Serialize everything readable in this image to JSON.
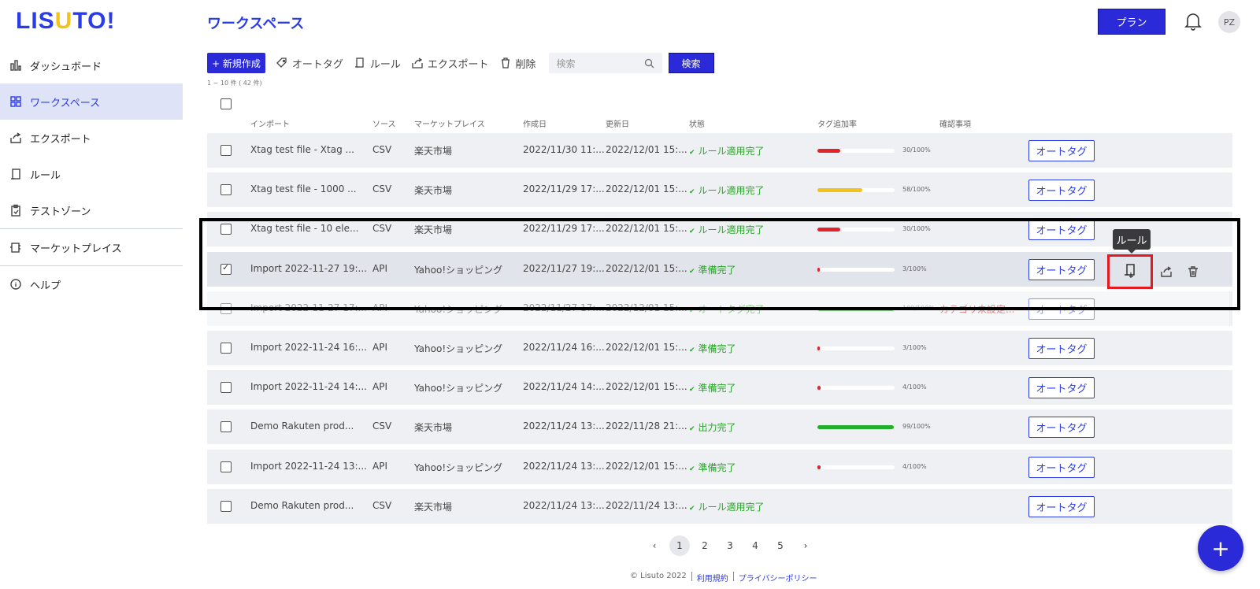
{
  "logo": {
    "text_a": "LIS",
    "text_u": "U",
    "text_b": "TO!"
  },
  "sidebar": {
    "items": [
      {
        "label": "ダッシュボード",
        "icon": "bar-chart-icon"
      },
      {
        "label": "ワークスペース",
        "icon": "grid-icon",
        "active": true
      },
      {
        "label": "エクスポート",
        "icon": "export-icon"
      },
      {
        "label": "ルール",
        "icon": "rule-icon"
      },
      {
        "label": "テストゾーン",
        "icon": "clipboard-icon"
      },
      {
        "label": "マーケットプレイス",
        "icon": "marketplace-icon"
      },
      {
        "label": "ヘルプ",
        "icon": "info-icon"
      }
    ]
  },
  "header": {
    "title": "ワークスペース",
    "plan_label": "プラン",
    "avatar_initials": "PZ"
  },
  "toolbar": {
    "new_label": "+ 新規作成",
    "autotag_label": "オートタグ",
    "rule_label": "ルール",
    "export_label": "エクスポート",
    "delete_label": "削除",
    "search_placeholder": "検索",
    "search_button": "検索"
  },
  "count_text": "1 ~ 10 件 ( 42 件)",
  "columns": [
    "インポート",
    "ソース",
    "マーケットプレイス",
    "作成日",
    "更新日",
    "状態",
    "タグ追加率",
    "確認事項"
  ],
  "rows": [
    {
      "name": "Xtag test file - Xtag ...",
      "source": "CSV",
      "market": "楽天市場",
      "created": "2022/11/30 11:...",
      "updated": "2022/12/01 15:...",
      "status": "ルール適用完了",
      "rate": 30,
      "rate_text": "30/100%",
      "color": "#e0242b",
      "note": ""
    },
    {
      "name": "Xtag test file - 1000 ...",
      "source": "CSV",
      "market": "楽天市場",
      "created": "2022/11/29 17:...",
      "updated": "2022/12/01 15:...",
      "status": "ルール適用完了",
      "rate": 58,
      "rate_text": "58/100%",
      "color": "#f2c31b",
      "note": ""
    },
    {
      "name": "Xtag test file - 10 ele...",
      "source": "CSV",
      "market": "楽天市場",
      "created": "2022/11/29 17:...",
      "updated": "2022/12/01 15:...",
      "status": "ルール適用完了",
      "rate": 30,
      "rate_text": "30/100%",
      "color": "#e0242b",
      "note": ""
    },
    {
      "name": "Import 2022-11-27 19:...",
      "source": "API",
      "market": "Yahoo!ショッピング",
      "created": "2022/11/27 19:...",
      "updated": "2022/12/01 15:...",
      "status": "準備完了",
      "rate": 3,
      "rate_text": "3/100%",
      "color": "#e0242b",
      "note": "",
      "selected": true
    },
    {
      "name": "Import 2022-11-27 17:...",
      "source": "API",
      "market": "Yahoo!ショッピング",
      "created": "2022/11/27 17:...",
      "updated": "2022/12/01 15:...",
      "status": "オートタグ完了",
      "rate": 100,
      "rate_text": "100/100%",
      "color": "#22b02a",
      "note": "カテゴリ未設定..."
    },
    {
      "name": "Import 2022-11-24 16:...",
      "source": "API",
      "market": "Yahoo!ショッピング",
      "created": "2022/11/24 16:...",
      "updated": "2022/12/01 15:...",
      "status": "準備完了",
      "rate": 3,
      "rate_text": "3/100%",
      "color": "#e0242b",
      "note": ""
    },
    {
      "name": "Import 2022-11-24 14:...",
      "source": "API",
      "market": "Yahoo!ショッピング",
      "created": "2022/11/24 14:...",
      "updated": "2022/12/01 15:...",
      "status": "準備完了",
      "rate": 4,
      "rate_text": "4/100%",
      "color": "#e0242b",
      "note": ""
    },
    {
      "name": "Demo Rakuten prod...",
      "source": "CSV",
      "market": "楽天市場",
      "created": "2022/11/24 13:...",
      "updated": "2022/11/28 21:...",
      "status": "出力完了",
      "rate": 99,
      "rate_text": "99/100%",
      "color": "#22b02a",
      "note": ""
    },
    {
      "name": "Import 2022-11-24 13:...",
      "source": "API",
      "market": "Yahoo!ショッピング",
      "created": "2022/11/24 13:...",
      "updated": "2022/12/01 15:...",
      "status": "準備完了",
      "rate": 4,
      "rate_text": "4/100%",
      "color": "#e0242b",
      "note": ""
    },
    {
      "name": "Demo Rakuten prod...",
      "source": "CSV",
      "market": "楽天市場",
      "created": "2022/11/24 13:...",
      "updated": "2022/11/24 13:...",
      "status": "ルール適用完了",
      "rate": null,
      "rate_text": "",
      "color": "",
      "note": ""
    }
  ],
  "autotag_button": "オートタグ",
  "tooltip": "ルール",
  "pagination": {
    "prev": "‹",
    "next": "›",
    "pages": [
      "1",
      "2",
      "3",
      "4",
      "5"
    ],
    "current": "1"
  },
  "footer": {
    "copyright": "© Lisuto 2022",
    "terms": "利用規約",
    "privacy": "プライバシーポリシー"
  },
  "fab_label": "+"
}
